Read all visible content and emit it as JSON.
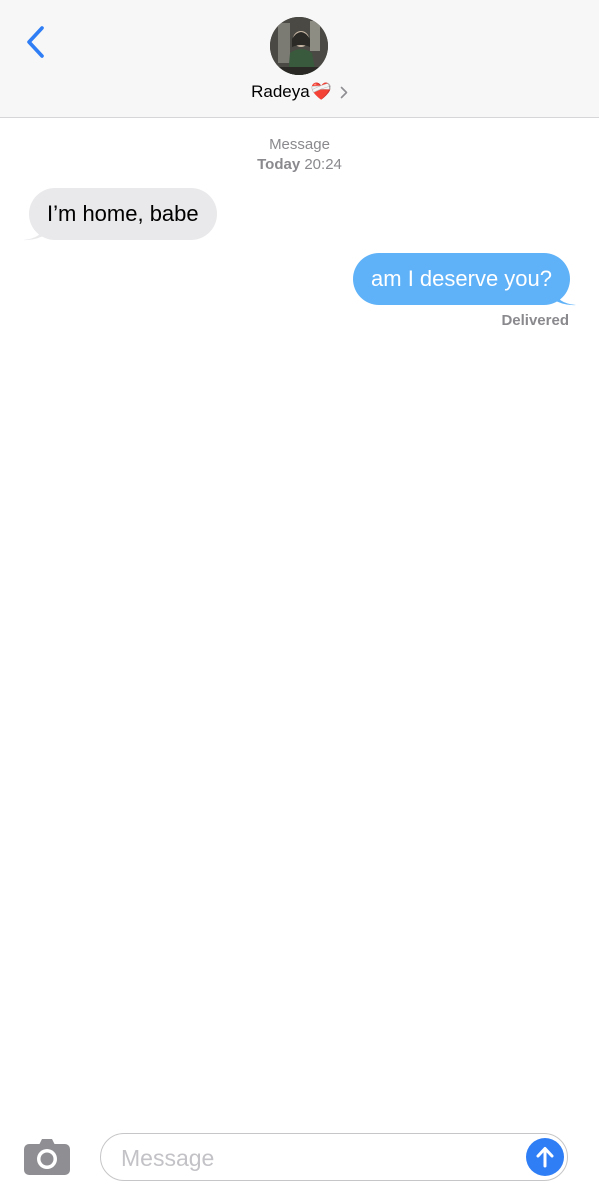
{
  "header": {
    "contact_name": "Radeya",
    "contact_emoji": "❤️‍🩹"
  },
  "thread": {
    "service": "Message",
    "date_label": "Today",
    "time": "20:24",
    "messages": [
      {
        "direction": "incoming",
        "text": "I’m home, babe"
      },
      {
        "direction": "outgoing",
        "text": "am I deserve you?"
      }
    ],
    "status": "Delivered"
  },
  "composer": {
    "placeholder": "Message"
  },
  "colors": {
    "accent": "#2f7ef6",
    "outgoing_bubble": "#5fb2f8",
    "incoming_bubble": "#e9e9eb",
    "meta_text": "#8a8a8e"
  },
  "icons": {
    "back": "chevron-left-icon",
    "contact_details": "chevron-right-icon",
    "camera": "camera-icon",
    "send": "arrow-up-icon"
  }
}
